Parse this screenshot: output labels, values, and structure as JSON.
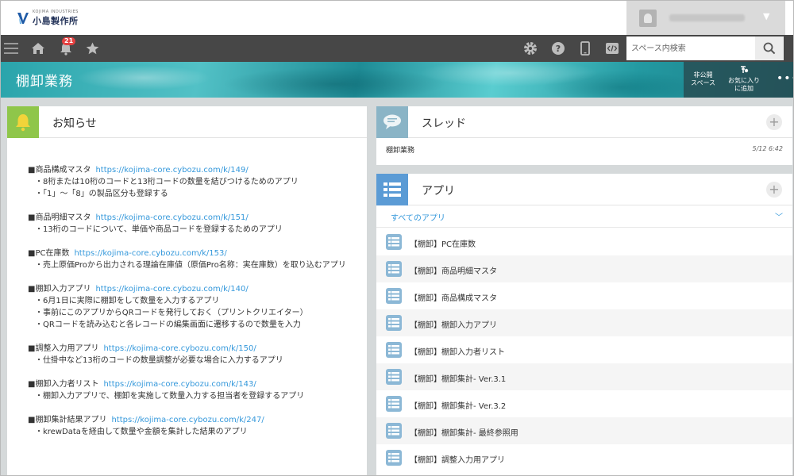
{
  "header": {
    "logo_text": "小島製作所",
    "logo_small": "KOJIMA INDUSTRIES"
  },
  "navbar": {
    "notification_count": "21",
    "search_placeholder": "スペース内検索"
  },
  "space": {
    "title": "棚卸業務",
    "private_label_1": "非公開",
    "private_label_2": "スペース",
    "favorite_label_1": "お気に入り",
    "favorite_label_2": "に追加"
  },
  "notice": {
    "title": "お知らせ",
    "blocks": [
      {
        "title": "■商品構成マスタ",
        "link": "https://kojima-core.cybozu.com/k/149/",
        "lines": [
          "・8桁または10桁のコードと13桁コードの数量を結びつけるためのアプリ",
          "・「1」～「8」の製品区分も登録する"
        ]
      },
      {
        "title": "■商品明細マスタ",
        "link": "https://kojima-core.cybozu.com/k/151/",
        "lines": [
          "・13桁のコードについて、単価や商品コードを登録するためのアプリ"
        ]
      },
      {
        "title": "■PC在庫数",
        "link": "https://kojima-core.cybozu.com/k/153/",
        "lines": [
          "・売上原価Proから出力される理論在庫値（原価Pro名称：実在庫数）を取り込むアプリ"
        ]
      },
      {
        "title": "■棚卸入力アプリ",
        "link": "https://kojima-core.cybozu.com/k/140/",
        "lines": [
          "・6月1日に実際に棚卸をして数量を入力するアプリ",
          "・事前にこのアプリからQRコードを発行しておく（プリントクリエイター）",
          "・QRコードを読み込むと各レコードの編集画面に遷移するので数量を入力"
        ]
      },
      {
        "title": "■調整入力用アプリ",
        "link": "https://kojima-core.cybozu.com/k/150/",
        "lines": [
          "・仕掛中など13桁のコードの数量調整が必要な場合に入力するアプリ"
        ]
      },
      {
        "title": "■棚卸入力者リスト",
        "link": "https://kojima-core.cybozu.com/k/143/",
        "lines": [
          "・棚卸入力アプリで、棚卸を実施して数量入力する担当者を登録するアプリ"
        ]
      },
      {
        "title": "■棚卸集計結果アプリ",
        "link": "https://kojima-core.cybozu.com/k/247/",
        "lines": [
          "・krewDataを経由して数量や金額を集計した結果のアプリ"
        ]
      }
    ]
  },
  "thread": {
    "title": "スレッド",
    "items": [
      {
        "name": "棚卸業務",
        "time": "5/12 6:42"
      }
    ]
  },
  "apps": {
    "title": "アプリ",
    "filter_label": "すべてのアプリ",
    "items": [
      "【棚卸】PC在庫数",
      "【棚卸】商品明細マスタ",
      "【棚卸】商品構成マスタ",
      "【棚卸】棚卸入力アプリ",
      "【棚卸】棚卸入力者リスト",
      "【棚卸】棚卸集計- Ver.3.1",
      "【棚卸】棚卸集計- Ver.3.2",
      "【棚卸】棚卸集計- 最終参照用",
      "【棚卸】調整入力用アプリ"
    ]
  },
  "colors": {
    "nav_bg": "#474747",
    "notice_icon": "#8fc64a",
    "thread_icon": "#8ab4c6",
    "apps_icon": "#5b9bd5",
    "link": "#3498db",
    "badge": "#e64141"
  }
}
